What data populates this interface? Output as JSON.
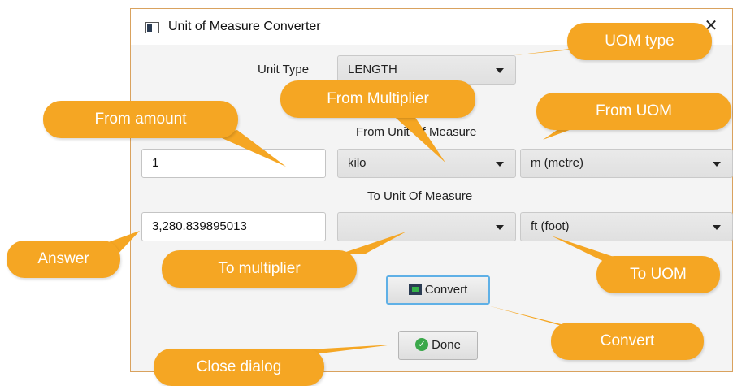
{
  "window": {
    "title": "Unit of Measure Converter",
    "close_glyph": "✕"
  },
  "form": {
    "unit_type_label": "Unit Type",
    "unit_type_value": "LENGTH",
    "from_section_label": "From Unit Of Measure",
    "from_amount": "1",
    "from_multiplier": "kilo",
    "from_uom": "m (metre)",
    "to_section_label": "To Unit Of Measure",
    "answer": "3,280.839895013",
    "to_multiplier": "",
    "to_uom": "ft (foot)",
    "convert_label": "Convert",
    "done_label": "Done",
    "done_glyph": "✓"
  },
  "callouts": {
    "uom_type": "UOM type",
    "from_multiplier": "From Multiplier",
    "from_amount": "From amount",
    "from_uom": "From UOM",
    "answer": "Answer",
    "to_multiplier": "To multiplier",
    "to_uom": "To UOM",
    "convert": "Convert",
    "close_dialog": "Close dialog"
  },
  "colors": {
    "callout": "#f5a623",
    "focus_border": "#5fb0e6"
  }
}
